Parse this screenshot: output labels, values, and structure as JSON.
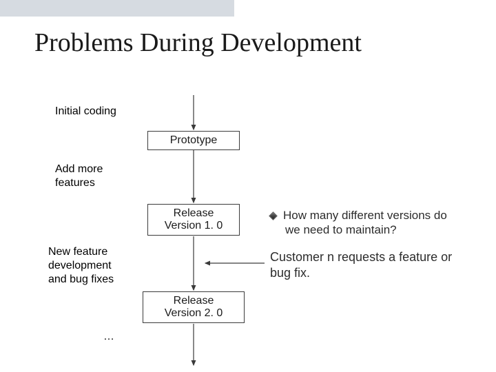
{
  "title": "Problems During Development",
  "labels": {
    "initial": "Initial coding",
    "addmore": "Add more\nfeatures",
    "newfeat": "New feature\ndevelopment\nand bug fixes",
    "ellipsis": "…"
  },
  "boxes": {
    "prototype": "Prototype",
    "release1": "Release\nVersion 1. 0",
    "release2": "Release\nVersion 2. 0"
  },
  "bullets": {
    "howmany_line1": "How many different versions do",
    "howmany_line2": "we need to maintain?"
  },
  "request": {
    "line1": "Customer n requests a feature or",
    "line2": "bug fix."
  },
  "colors": {
    "arrow": "#3a3a3a",
    "band": "#d6dbe1"
  }
}
